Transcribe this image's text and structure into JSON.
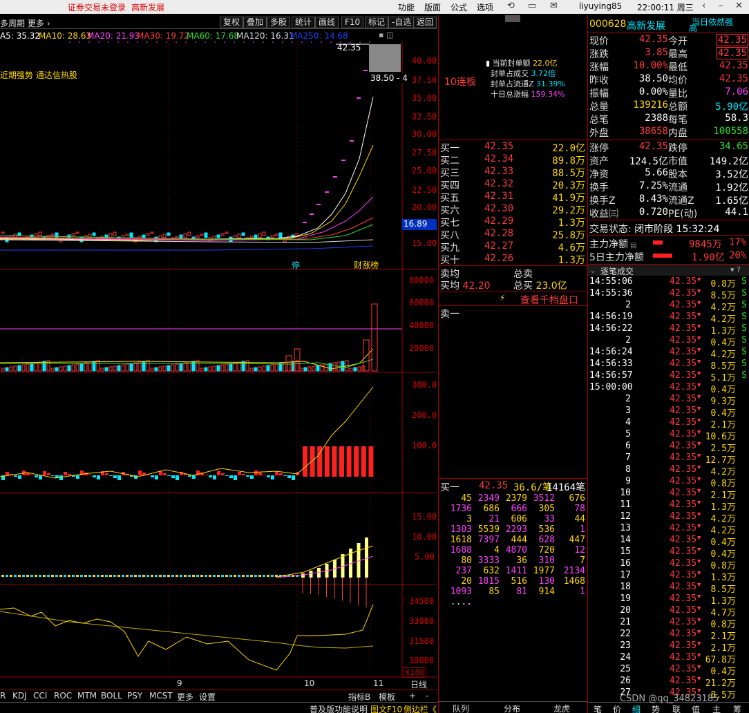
{
  "topbar": {
    "warn1": "证券交易未登录",
    "warn2": "高新发展",
    "menus": [
      "功能",
      "版面",
      "公式",
      "选项"
    ],
    "user": "liyuying85",
    "clock": "22:00:11 周三"
  },
  "toolbar": {
    "period": "多周期",
    "more": "更多",
    "buttons": [
      "复权",
      "叠加",
      "多股",
      "统计",
      "画线",
      "F10",
      "标记",
      "-自选",
      "返回"
    ]
  },
  "ma_legend": [
    {
      "label": "A5: 35.32",
      "color": "#ffffff"
    },
    {
      "label": "MA10: 28.63",
      "color": "#ffd800"
    },
    {
      "label": "MA20: 21.93",
      "color": "#ff40ff"
    },
    {
      "label": "MA30: 19.72",
      "color": "#ff3b3b"
    },
    {
      "label": "MA60: 17.68",
      "color": "#2ee02e"
    },
    {
      "label": "MA120: 16.31",
      "color": "#dddddd"
    },
    {
      "label": "MA250: 14.68",
      "color": "#2040ff"
    }
  ],
  "kchart": {
    "tag": "近期强势 通达信热股",
    "price_label": "42.35",
    "range_label": "38.50 - 4",
    "current": "16.89",
    "ticks": [
      "40.00",
      "37.50",
      "35.00",
      "32.50",
      "30.00",
      "27.50",
      "25.00",
      "22.50",
      "20.00",
      "17.50",
      "15.00"
    ],
    "tag_stop": "停",
    "tag_rank": "财涨榜"
  },
  "volume": {
    "ticks": [
      "80000",
      "60000",
      "40000",
      "20000"
    ]
  },
  "ind2": {
    "ticks": [
      "300.0",
      "200.0",
      "100.0"
    ]
  },
  "ind3": {
    "ticks": [
      "15.00",
      "10.00",
      "5.00"
    ]
  },
  "ind4": {
    "ticks": [
      "34500",
      "33000",
      "31500",
      "30000"
    ],
    "unit": "X100"
  },
  "xaxis": {
    "labels": [
      "9",
      "10",
      "11"
    ],
    "right": "日线"
  },
  "bottom_tabs": [
    "R",
    "KDJ",
    "CCI",
    "ROC",
    "MTM",
    "BOLL",
    "PSY",
    "MCST",
    "更多",
    "设置"
  ],
  "bottom_right": [
    "指标B",
    "模板",
    "+",
    "-"
  ],
  "status_left": [
    "普及版功能说明",
    "图文F10",
    "侧边栏《"
  ],
  "mid": {
    "streak": "10连板",
    "info": [
      {
        "label": "当前封单额",
        "value": "22.0亿"
      },
      {
        "label": "封单占成交",
        "value": "3.72倍"
      },
      {
        "label": "封单占流通Z",
        "value": "31.39%"
      },
      {
        "label": "十日总涨幅",
        "value": "159.34%"
      }
    ],
    "bids": [
      {
        "l": "买一",
        "p": "42.35",
        "v": "22.0亿"
      },
      {
        "l": "买二",
        "p": "42.34",
        "v": "89.8万"
      },
      {
        "l": "买三",
        "p": "42.33",
        "v": "88.5万"
      },
      {
        "l": "买四",
        "p": "42.32",
        "v": "20.3万"
      },
      {
        "l": "买五",
        "p": "42.31",
        "v": "41.9万"
      },
      {
        "l": "买六",
        "p": "42.30",
        "v": "29.2万"
      },
      {
        "l": "买七",
        "p": "42.29",
        "v": "1.3万"
      },
      {
        "l": "买八",
        "p": "42.28",
        "v": "25.8万"
      },
      {
        "l": "买九",
        "p": "42.27",
        "v": "4.6万"
      },
      {
        "l": "买十",
        "p": "42.26",
        "v": "1.3万"
      }
    ],
    "avg_sell_l": "卖均",
    "total_sell_l": "总卖",
    "avg_buy_l": "买均",
    "avg_buy_v": "42.20",
    "total_buy_l": "总买",
    "total_buy_v": "23.0亿",
    "thousand": "查看千档盘口",
    "sell1": "卖一",
    "buy1_l": "买一",
    "buy1_p": "42.35",
    "buy1_avg": "36.6/笔",
    "buy1_cnt": "14164笔",
    "queue": [
      [
        "45",
        "2349",
        "2379",
        "3512",
        "676"
      ],
      [
        "1736",
        "686",
        "666",
        "305",
        "78"
      ],
      [
        "3",
        "21",
        "606",
        "33",
        "44"
      ],
      [
        "1303",
        "5539",
        "2293",
        "536",
        "1"
      ],
      [
        "1618",
        "7397",
        "444",
        "628",
        "447"
      ],
      [
        "1688",
        "4",
        "4870",
        "720",
        "12"
      ],
      [
        "80",
        "3333",
        "36",
        "310",
        "7"
      ],
      [
        "237",
        "632",
        "1411",
        "1977",
        "2134"
      ],
      [
        "20",
        "1815",
        "516",
        "130",
        "1468"
      ],
      [
        "1093",
        "85",
        "81",
        "914",
        "1"
      ],
      [
        "....",
        "",
        "",
        "",
        ""
      ]
    ],
    "bottom_tabs": [
      "队列",
      "分布",
      "龙虎"
    ]
  },
  "right": {
    "theme": "当日依然强",
    "code": "000628",
    "name": "高新发展",
    "sub": "高",
    "quote": [
      {
        "a": "现价",
        "av": "42.35",
        "ac": "red",
        "b": "今开",
        "bv": "42.35",
        "bc": "redbox"
      },
      {
        "a": "涨跌",
        "av": "3.85",
        "ac": "red",
        "b": "最高",
        "bv": "42.35",
        "bc": "redbox"
      },
      {
        "a": "涨幅",
        "av": "10.00%",
        "ac": "red",
        "b": "最低",
        "bv": "42.35",
        "bc": "red"
      },
      {
        "a": "昨收",
        "av": "38.50",
        "ac": "wht",
        "b": "均价",
        "bv": "42.35",
        "bc": "red"
      },
      {
        "a": "振幅",
        "av": "0.00%",
        "ac": "wht",
        "b": "量比",
        "bv": "7.06",
        "bc": "mag"
      },
      {
        "a": "总量",
        "av": "139216",
        "ac": "yel",
        "b": "总额",
        "bv": "5.90亿",
        "bc": "cyan"
      },
      {
        "a": "总笔",
        "av": "2388",
        "ac": "wht",
        "b": "每笔",
        "bv": "58.3",
        "bc": "wht"
      },
      {
        "a": "外盘",
        "av": "38658",
        "ac": "red",
        "b": "内盘",
        "bv": "100558",
        "bc": "grn"
      }
    ],
    "stats": [
      {
        "a": "涨停",
        "av": "42.35",
        "ac": "red",
        "b": "跌停",
        "bv": "34.65",
        "bc": "grn"
      },
      {
        "a": "资产",
        "av": "124.5亿",
        "ac": "wht",
        "b": "市值",
        "bv": "149.2亿",
        "bc": "wht"
      },
      {
        "a": "净资",
        "av": "5.66",
        "ac": "wht",
        "b": "股本",
        "bv": "3.52亿",
        "bc": "wht"
      },
      {
        "a": "换手",
        "av": "7.25%",
        "ac": "wht",
        "b": "流通",
        "bv": "1.92亿",
        "bc": "wht"
      },
      {
        "a": "换手Z",
        "av": "8.43%",
        "ac": "wht",
        "b": "流通Z",
        "bv": "1.65亿",
        "bc": "wht"
      },
      {
        "a": "收益㈢",
        "av": "0.720",
        "ac": "wht",
        "b": "PE(动)",
        "bv": "44.1",
        "bc": "wht"
      }
    ],
    "trade_state_l": "交易状态:",
    "trade_state_v": "闭市阶段 15:32:24",
    "flow1_l": "主力净额",
    "flow1_v": "9845万",
    "flow1_p": "17%",
    "flow2_l": "5日主力净额",
    "flow2_v": "1.90亿",
    "flow2_p": "20%",
    "ticks_title": "逐笔成交",
    "ticks": [
      {
        "t": "14:55:06",
        "p": "42.35",
        "v": "0.8万",
        "s": "S"
      },
      {
        "t": "14:55:36",
        "p": "42.35",
        "v": "8.5万",
        "s": "S"
      },
      {
        "t": "2",
        "p": "42.35",
        "v": "4.2万",
        "s": "S"
      },
      {
        "t": "14:56:19",
        "p": "42.35",
        "v": "4.2万",
        "s": "S"
      },
      {
        "t": "14:56:22",
        "p": "42.35",
        "v": "1.3万",
        "s": "S"
      },
      {
        "t": "2",
        "p": "42.35",
        "v": "0.4万",
        "s": "S"
      },
      {
        "t": "14:56:24",
        "p": "42.35",
        "v": "4.2万",
        "s": "S"
      },
      {
        "t": "14:56:33",
        "p": "42.35",
        "v": "8.5万",
        "s": "S"
      },
      {
        "t": "14:56:57",
        "p": "42.35",
        "v": "5.1万",
        "s": "S"
      },
      {
        "t": "15:00:00",
        "p": "42.35",
        "v": "0.4万",
        "s": ""
      },
      {
        "t": "2",
        "p": "42.35",
        "v": "9.3万",
        "s": ""
      },
      {
        "t": "3",
        "p": "42.35",
        "v": "0.4万",
        "s": ""
      },
      {
        "t": "4",
        "p": "42.35",
        "v": "2.1万",
        "s": ""
      },
      {
        "t": "5",
        "p": "42.35",
        "v": "10.6万",
        "s": ""
      },
      {
        "t": "6",
        "p": "42.35",
        "v": "2.5万",
        "s": ""
      },
      {
        "t": "7",
        "p": "42.35",
        "v": "12.7万",
        "s": ""
      },
      {
        "t": "8",
        "p": "42.35",
        "v": "4.2万",
        "s": ""
      },
      {
        "t": "9",
        "p": "42.35",
        "v": "0.8万",
        "s": ""
      },
      {
        "t": "10",
        "p": "42.35",
        "v": "2.1万",
        "s": ""
      },
      {
        "t": "11",
        "p": "42.35",
        "v": "1.3万",
        "s": ""
      },
      {
        "t": "12",
        "p": "42.35",
        "v": "4.2万",
        "s": ""
      },
      {
        "t": "13",
        "p": "42.35",
        "v": "4.2万",
        "s": ""
      },
      {
        "t": "14",
        "p": "42.35",
        "v": "0.4万",
        "s": ""
      },
      {
        "t": "15",
        "p": "42.35",
        "v": "0.4万",
        "s": ""
      },
      {
        "t": "16",
        "p": "42.35",
        "v": "0.8万",
        "s": ""
      },
      {
        "t": "17",
        "p": "42.35",
        "v": "1.3万",
        "s": ""
      },
      {
        "t": "18",
        "p": "42.35",
        "v": "8.5万",
        "s": ""
      },
      {
        "t": "19",
        "p": "42.35",
        "v": "1.3万",
        "s": ""
      },
      {
        "t": "20",
        "p": "42.35",
        "v": "4.7万",
        "s": ""
      },
      {
        "t": "21",
        "p": "42.35",
        "v": "0.8万",
        "s": ""
      },
      {
        "t": "22",
        "p": "42.35",
        "v": "2.1万",
        "s": ""
      },
      {
        "t": "23",
        "p": "42.35",
        "v": "2.1万",
        "s": ""
      },
      {
        "t": "24",
        "p": "42.35",
        "v": "67.8万",
        "s": ""
      },
      {
        "t": "25",
        "p": "42.35",
        "v": "0.4万",
        "s": ""
      },
      {
        "t": "26",
        "p": "42.35",
        "v": "21.2万",
        "s": ""
      },
      {
        "t": "27",
        "p": "42.35",
        "v": "8.5万",
        "s": ""
      }
    ],
    "bottom_tabs": [
      "笔",
      "价",
      "细",
      "势",
      "联",
      "值",
      "主",
      "筹"
    ],
    "watermark": "CSDN @qq_34823185"
  }
}
